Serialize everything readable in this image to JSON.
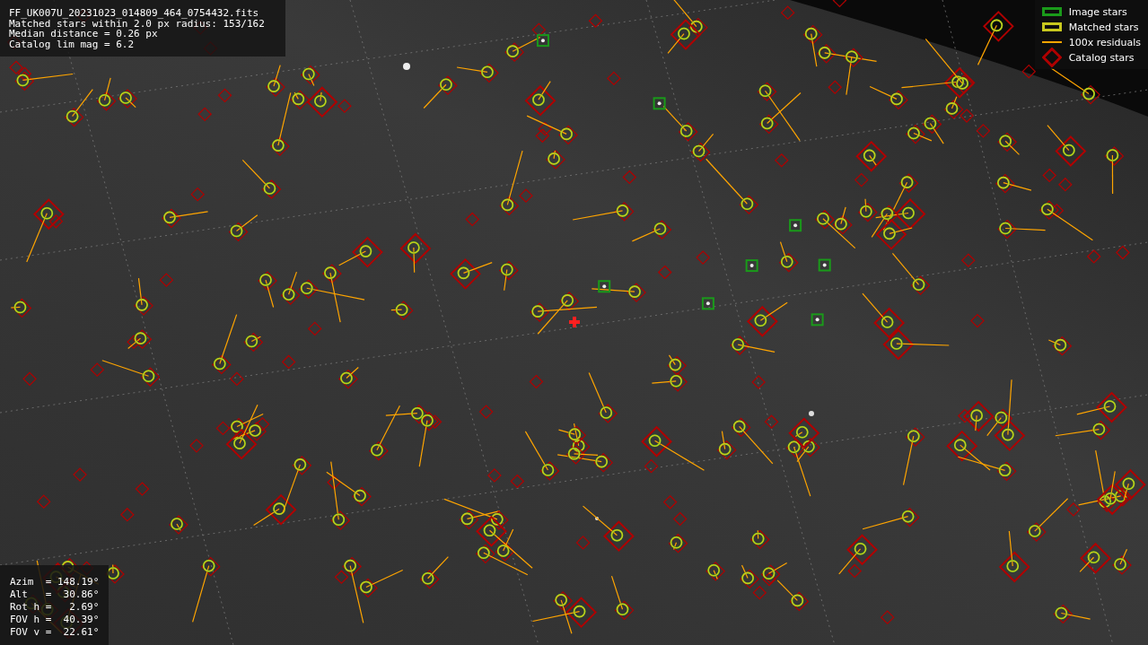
{
  "info_box": {
    "lines": [
      "FF_UK007U_20231023_014809_464_0754432.fits",
      "Matched stars within 2.0 px radius: 153/162",
      "Median distance = 0.26 px",
      "Catalog lim mag = 6.2"
    ]
  },
  "legend": {
    "items": [
      {
        "kind": "box",
        "color": "#1a9a1a",
        "label": "Image stars"
      },
      {
        "kind": "box",
        "color": "#c8c81e",
        "label": "Matched stars"
      },
      {
        "kind": "line",
        "color": "#ffa500",
        "label": "100x residuals"
      },
      {
        "kind": "diamond",
        "color": "#b00000",
        "label": "Catalog stars"
      }
    ]
  },
  "pointing_box": {
    "lines": [
      "Azim  = 148.19°",
      "Alt   =  30.86°",
      "Rot h =   2.69°",
      "FOV h =  40.39°",
      "FOV v =  22.61°"
    ]
  }
}
